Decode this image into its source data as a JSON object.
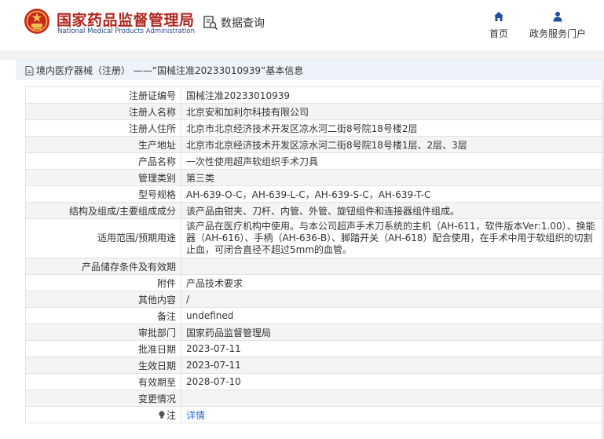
{
  "header": {
    "brand_cn": "国家药品监督管理局",
    "brand_en": "National Medical Products Administration",
    "data_query_label": "数据查询",
    "nav": [
      {
        "label": "首页",
        "icon": "home-icon"
      },
      {
        "label": "政务服务门户",
        "icon": "user-icon"
      }
    ]
  },
  "breadcrumb": {
    "text": "境内医疗器械（注册） ——“国械注准20233010939”基本信息"
  },
  "colors": {
    "brand_red": "#b0251e",
    "brand_blue": "#2a4a8a",
    "link_blue": "#2a6cc7",
    "crumb_bg": "#eef3f9"
  },
  "rows": [
    {
      "label": "注册证编号",
      "value": "国械注准20233010939"
    },
    {
      "label": "注册人名称",
      "value": "北京安和加利尔科技有限公司"
    },
    {
      "label": "注册人住所",
      "value": "北京市北京经济技术开发区凉水河二街8号院18号楼2层"
    },
    {
      "label": "生产地址",
      "value": "北京市北京经济技术开发区凉水河二街8号院18号楼1层、2层、3层"
    },
    {
      "label": "产品名称",
      "value": "一次性使用超声软组织手术刀具"
    },
    {
      "label": "管理类别",
      "value": "第三类"
    },
    {
      "label": "型号规格",
      "value": "AH-639-O-C，AH-639-L-C，AH-639-S-C，AH-639-T-C"
    },
    {
      "label": "结构及组成/主要组成成分",
      "value": "该产品由钳夹、刀杆、内管、外管、旋钮组件和连接器组件组成。"
    },
    {
      "label": "适用范围/预期用途",
      "value": "该产品在医疗机构中使用。与本公司超声手术刀系统的主机（AH-611，软件版本Ver:1.00）、换能器（AH-616）、手柄（AH-636-B）、脚踏开关（AH-618）配合使用，在手术中用于软组织的切割止血，可闭合直径不超过5mm的血管。"
    },
    {
      "label": "产品储存条件及有效期",
      "value": ""
    },
    {
      "label": "附件",
      "value": "产品技术要求"
    },
    {
      "label": "其他内容",
      "value": "/"
    },
    {
      "label": "备注",
      "value": "undefined"
    },
    {
      "label": "审批部门",
      "value": "国家药品监督管理局"
    },
    {
      "label": "批准日期",
      "value": "2023-07-11"
    },
    {
      "label": "生效日期",
      "value": "2023-07-11"
    },
    {
      "label": "有效期至",
      "value": "2028-07-10"
    },
    {
      "label": "变更情况",
      "value": ""
    },
    {
      "label": "注",
      "value": "详情",
      "icon": "lightbulb-icon"
    }
  ]
}
